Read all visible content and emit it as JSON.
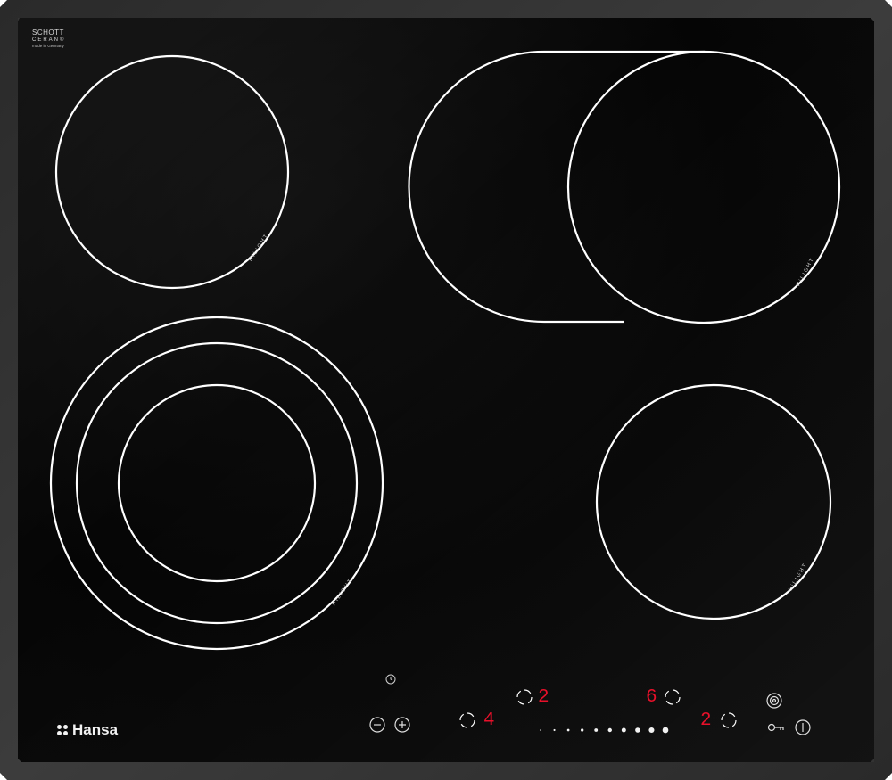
{
  "panel": {
    "glass_color": "#050505",
    "frame_color": "#3a3a3a",
    "ring_color": "#ffffff",
    "display_color": "#e8102a"
  },
  "brand": {
    "glass_maker_line1": "SCHOTT",
    "glass_maker_line2": "CERAN®",
    "glass_maker_line3": "made in Germany",
    "logo_text": "Hansa"
  },
  "zones": {
    "front_left": {
      "label": "HiLIGHT",
      "rings": 3
    },
    "back_left": {
      "label": "HiLIGHT",
      "rings": 1
    },
    "back_right": {
      "label": "HiLIGHT",
      "type": "oval extended"
    },
    "front_right": {
      "label": "HiLIGHT",
      "rings": 1
    }
  },
  "controls": {
    "timer_icon": "clock-icon",
    "minus_icon": "minus-icon",
    "plus_icon": "plus-icon",
    "dual_zone_icon": "dual-ring-icon",
    "lock_icon": "key-icon",
    "power_icon": "power-icon",
    "front_left_level": "4",
    "back_left_level": "2",
    "back_right_level": "6",
    "front_right_level": "2",
    "slider_level": 10,
    "slider_steps": 10
  }
}
